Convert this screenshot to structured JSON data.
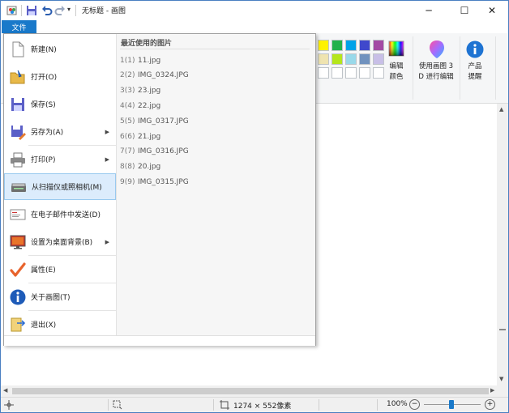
{
  "window": {
    "title": "无标题 - 画图",
    "controls": {
      "minimize": "─",
      "maximize": "☐",
      "close": "✕"
    }
  },
  "ribbon": {
    "file_tab": "文件",
    "edit_colors": [
      "编辑",
      "颜色"
    ],
    "paint3d": [
      "使用画图 3",
      "D 进行编辑"
    ],
    "product_alert": [
      "产品",
      "提醒"
    ],
    "colors_row1": [
      "#fff200",
      "#22b14c",
      "#00a2e8",
      "#3f48cc",
      "#a349a4"
    ],
    "colors_row2": [
      "#efe4b0",
      "#b5e61d",
      "#99d9ea",
      "#7092be",
      "#c8bfe7"
    ],
    "colors_row3": [
      "#ffffff",
      "#ffffff",
      "#ffffff",
      "#ffffff",
      "#ffffff"
    ]
  },
  "file_menu": {
    "items": [
      {
        "label": "新建(N)",
        "arrow": ""
      },
      {
        "label": "打开(O)",
        "arrow": ""
      },
      {
        "label": "保存(S)",
        "arrow": ""
      },
      {
        "label": "另存为(A)",
        "arrow": "▶"
      },
      {
        "label": "打印(P)",
        "arrow": "▶"
      },
      {
        "label": "从扫描仪或照相机(M)",
        "arrow": ""
      },
      {
        "label": "在电子邮件中发送(D)",
        "arrow": ""
      },
      {
        "label": "设置为桌面背景(B)",
        "arrow": "▶"
      },
      {
        "label": "属性(E)",
        "arrow": ""
      },
      {
        "label": "关于画图(T)",
        "arrow": ""
      },
      {
        "label": "退出(X)",
        "arrow": ""
      }
    ],
    "recent_title": "最近使用的图片",
    "recent": [
      {
        "num": "1(1)",
        "name": "11.jpg"
      },
      {
        "num": "2(2)",
        "name": "IMG_0324.JPG"
      },
      {
        "num": "3(3)",
        "name": "23.jpg"
      },
      {
        "num": "4(4)",
        "name": "22.jpg"
      },
      {
        "num": "5(5)",
        "name": "IMG_0317.JPG"
      },
      {
        "num": "6(6)",
        "name": "21.jpg"
      },
      {
        "num": "7(7)",
        "name": "IMG_0316.JPG"
      },
      {
        "num": "8(8)",
        "name": "20.jpg"
      },
      {
        "num": "9(9)",
        "name": "IMG_0315.JPG"
      }
    ]
  },
  "statusbar": {
    "dimensions": "1274 × 552像素",
    "zoom": "100%",
    "zoom_out": "−",
    "zoom_in": "+"
  }
}
